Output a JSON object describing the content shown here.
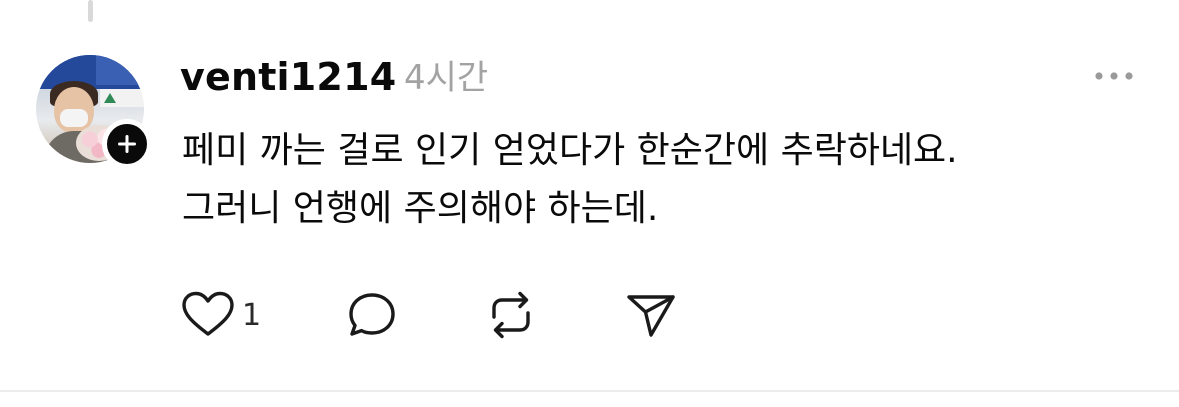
{
  "post": {
    "username": "venti1214",
    "timestamp": "4시간",
    "text_lines": [
      "페미 까는 걸로 인기 얻었다가 한순간에 추락하네요.",
      "그러니 언행에 주의해야 하는데."
    ],
    "like_count": "1"
  },
  "icons": {
    "more": "more-horizontal-icon",
    "like": "heart-icon",
    "comment": "comment-bubble-icon",
    "repost": "repost-icon",
    "share": "send-icon",
    "follow": "plus-icon"
  },
  "colors": {
    "text": "#0a0a0a",
    "muted": "#a3a3a3",
    "badge": "#0a0a0a"
  }
}
